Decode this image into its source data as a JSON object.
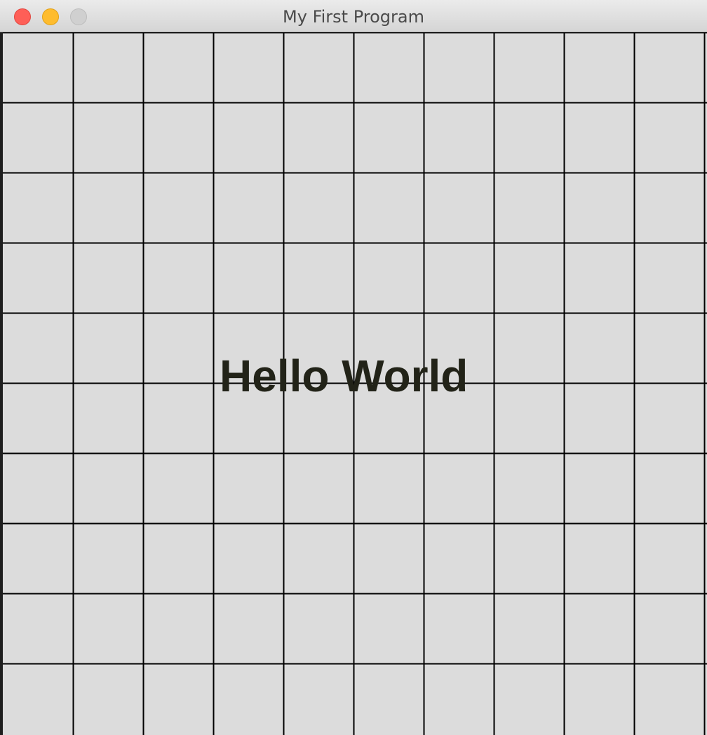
{
  "window": {
    "title": "My First Program",
    "controls": {
      "close": "close-button",
      "minimize": "minimize-button",
      "zoom": "zoom-button"
    }
  },
  "canvas": {
    "text": "Hello World",
    "grid_rows": 10,
    "grid_cols": 10,
    "colors": {
      "background": "#dcdcdc",
      "grid_line": "#000000",
      "text": "#222318"
    }
  }
}
